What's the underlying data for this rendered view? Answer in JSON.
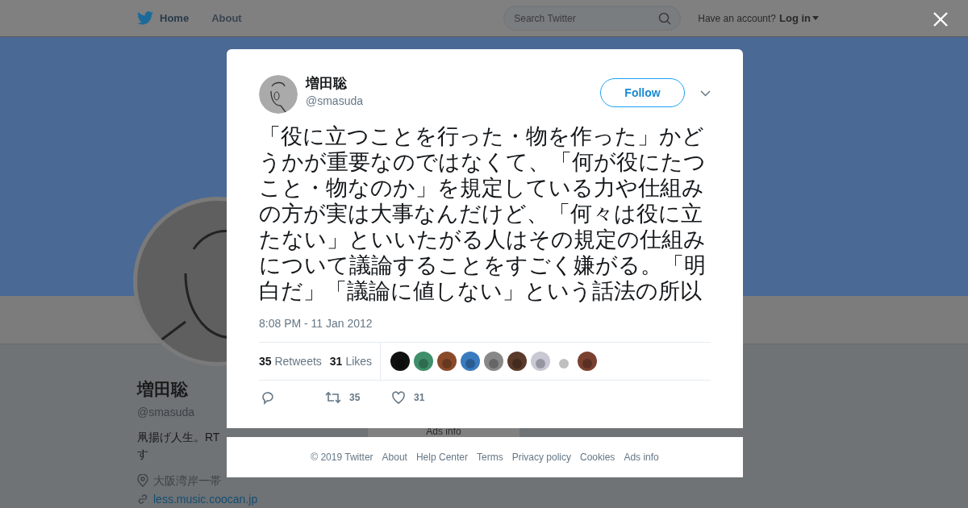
{
  "nav": {
    "items": [
      {
        "label": "Home",
        "selected": true
      },
      {
        "label": "About",
        "selected": false
      }
    ],
    "search": {
      "placeholder": "Search Twitter"
    },
    "account_prompt": "Have an account?",
    "login": "Log in"
  },
  "profile": {
    "name": "増田聡",
    "handle": "@smasuda",
    "bio_lines": [
      "凧揚げ人生。RT",
      "す"
    ],
    "location": "大阪湾岸一帯",
    "url": "less.music.coocan.jp",
    "ads_info": "Ads info"
  },
  "tweet": {
    "name": "増田聡",
    "handle": "@smasuda",
    "follow": "Follow",
    "text": "「役に立つことを行った・物を作った」かどうかが重要なのではなくて、「何が役にたつこと・物なのか」を規定している力や仕組みの方が実は大事なんだけど、「何々は役に立たない」といいたがる人はその規定の仕組みについて議論することをすごく嫌がる。「明白だ」「議論に値しない」という話法の所以",
    "time": "8:08 PM - 11 Jan 2012",
    "retweets": {
      "count": "35",
      "label": "Retweets"
    },
    "likes": {
      "count": "31",
      "label": "Likes"
    },
    "actions": [
      {
        "kind": "reply"
      },
      {
        "kind": "retweet",
        "count": "35"
      },
      {
        "kind": "like",
        "count": "31"
      }
    ]
  },
  "footer": [
    "© 2019 Twitter",
    "About",
    "Help Center",
    "Terms",
    "Privacy policy",
    "Cookies",
    "Ads info"
  ]
}
